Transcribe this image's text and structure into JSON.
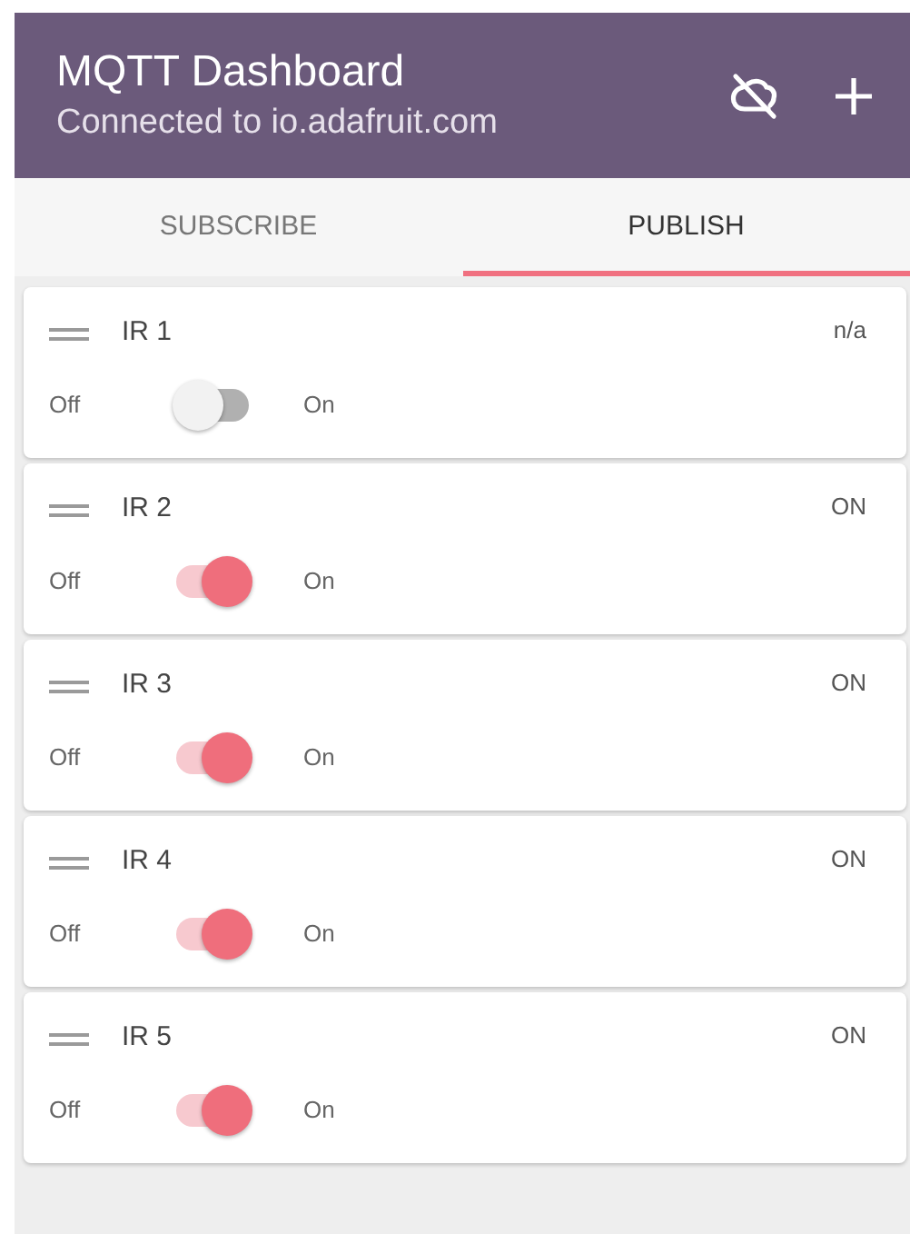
{
  "header": {
    "title": "MQTT Dashboard",
    "subtitle": "Connected to io.adafruit.com"
  },
  "tabs": [
    {
      "label": "SUBSCRIBE",
      "selected": false
    },
    {
      "label": "PUBLISH",
      "selected": true
    }
  ],
  "cards": [
    {
      "name": "IR 1",
      "status": "n/a",
      "off_label": "Off",
      "on_label": "On",
      "on": false
    },
    {
      "name": "IR 2",
      "status": "ON",
      "off_label": "Off",
      "on_label": "On",
      "on": true
    },
    {
      "name": "IR 3",
      "status": "ON",
      "off_label": "Off",
      "on_label": "On",
      "on": true
    },
    {
      "name": "IR 4",
      "status": "ON",
      "off_label": "Off",
      "on_label": "On",
      "on": true
    },
    {
      "name": "IR 5",
      "status": "ON",
      "off_label": "Off",
      "on_label": "On",
      "on": true
    }
  ]
}
